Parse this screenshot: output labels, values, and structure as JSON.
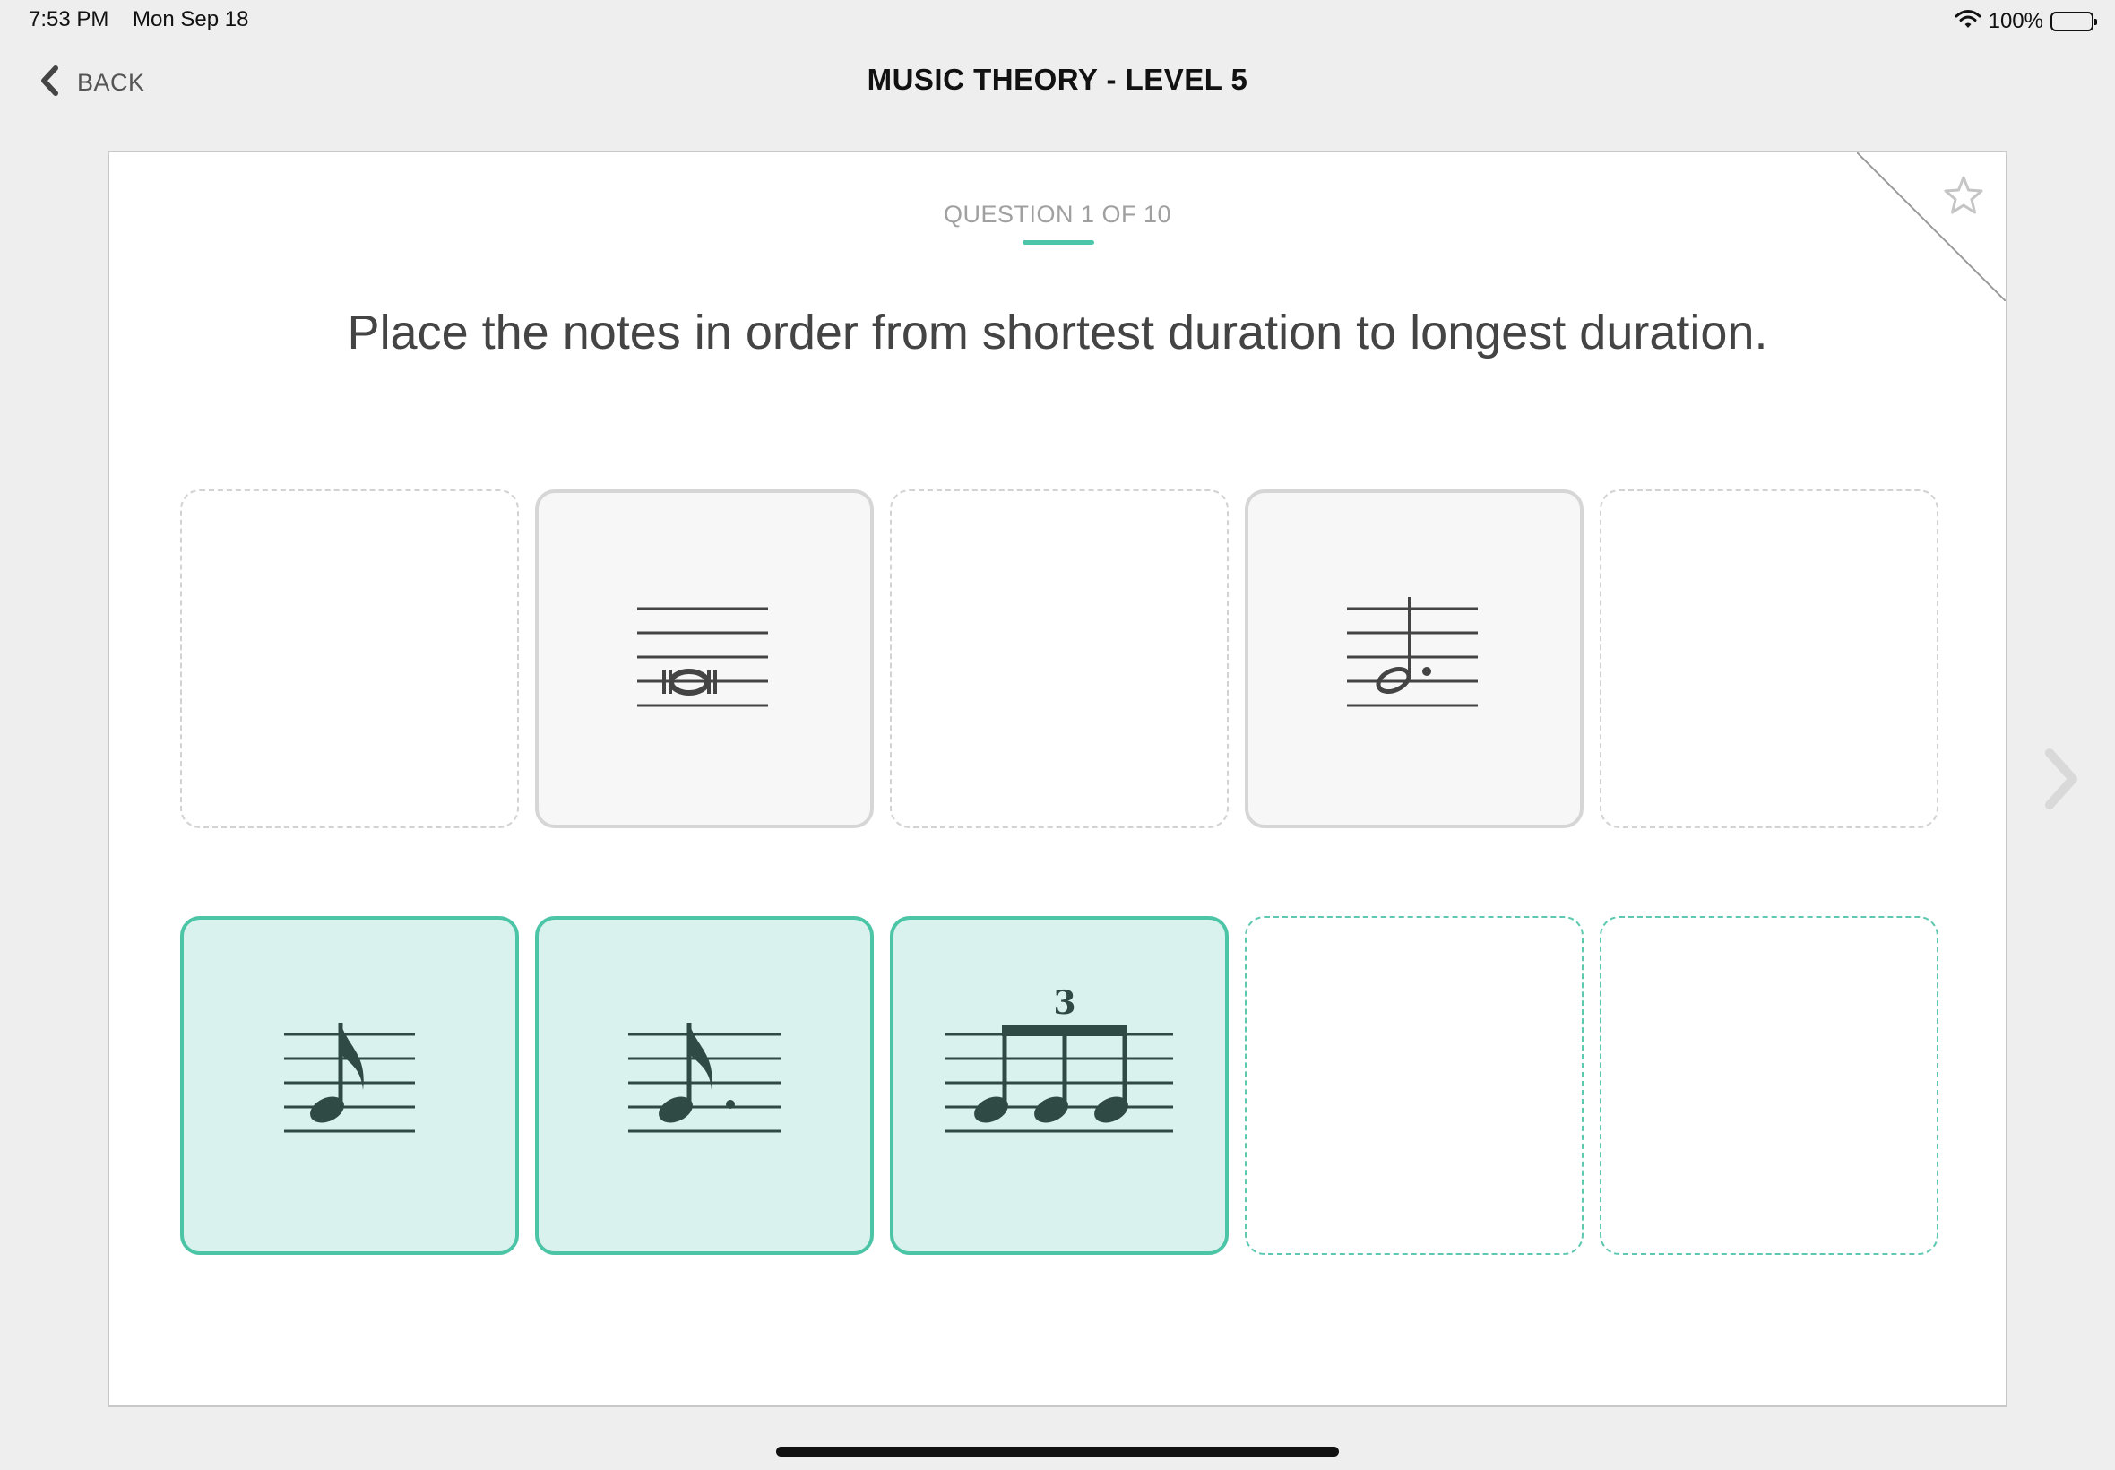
{
  "status_bar": {
    "time": "7:53 PM",
    "date": "Mon Sep 18",
    "battery": "100%"
  },
  "nav": {
    "back_label": "BACK",
    "title": "MUSIC THEORY - LEVEL 5"
  },
  "quiz": {
    "question_label": "QUESTION 1 OF 10",
    "prompt": "Place the notes in order from shortest duration to longest duration.",
    "answer_slots": [
      {
        "state": "empty"
      },
      {
        "state": "placed",
        "note": "double-whole-note"
      },
      {
        "state": "empty"
      },
      {
        "state": "placed",
        "note": "dotted-half-note"
      },
      {
        "state": "empty"
      }
    ],
    "note_bank": [
      {
        "note": "eighth-note"
      },
      {
        "note": "dotted-eighth-note"
      },
      {
        "note": "eighth-note-triplet",
        "tuplet_label": "3"
      },
      {
        "state": "empty"
      },
      {
        "state": "empty"
      }
    ]
  },
  "icons": {
    "back": "chevron-left-icon",
    "favorite": "star-icon",
    "next": "chevron-right-icon",
    "wifi": "wifi-icon",
    "battery": "battery-icon"
  },
  "colors": {
    "accent": "#4cc4a6",
    "tile_fill": "#daf2ee",
    "background": "#eeeeee",
    "note_ink": "#2f4a45"
  }
}
